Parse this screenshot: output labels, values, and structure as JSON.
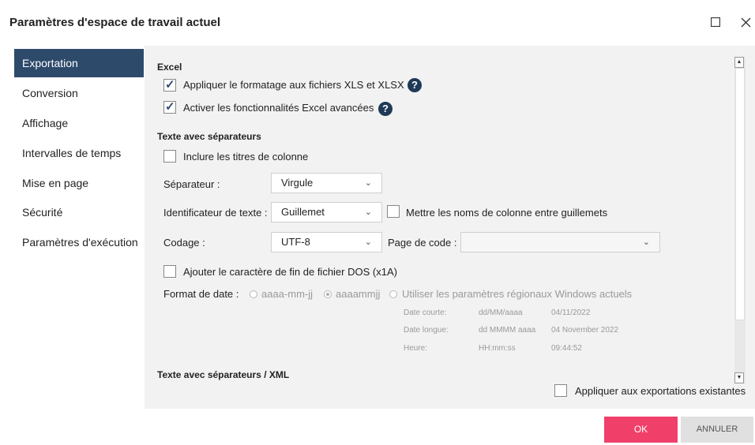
{
  "window": {
    "title": "Paramètres d'espace de travail actuel",
    "maximize_icon": "maximize-icon",
    "close_icon": "close-icon"
  },
  "sidebar": {
    "items": [
      {
        "label": "Exportation",
        "active": true
      },
      {
        "label": "Conversion",
        "active": false
      },
      {
        "label": "Affichage",
        "active": false
      },
      {
        "label": "Intervalles de temps",
        "active": false
      },
      {
        "label": "Mise en page",
        "active": false
      },
      {
        "label": "Sécurité",
        "active": false
      },
      {
        "label": "Paramètres d'exécution",
        "active": false
      }
    ]
  },
  "excel": {
    "title": "Excel",
    "apply_format": {
      "label": "Appliquer le formatage aux fichiers XLS et XLSX",
      "checked": true
    },
    "advanced": {
      "label": "Activer les fonctionnalités Excel avancées",
      "checked": true
    },
    "help": "?"
  },
  "delimited": {
    "title": "Texte avec séparateurs",
    "include_titles": {
      "label": "Inclure les titres de colonne",
      "checked": false
    },
    "separator": {
      "label": "Séparateur :",
      "value": "Virgule"
    },
    "text_qualifier": {
      "label": "Identificateur de texte :",
      "value": "Guillemet"
    },
    "quote_names": {
      "label": "Mettre les noms de colonne entre guillemets",
      "checked": false
    },
    "encoding": {
      "label": "Codage :",
      "value": "UTF-8"
    },
    "code_page": {
      "label": "Page de code :",
      "value": ""
    },
    "dos_eof": {
      "label": "Ajouter le caractère de fin de fichier DOS (x1A)",
      "checked": false
    },
    "date_format": {
      "label": "Format de date :",
      "options": [
        "aaaa-mm-jj",
        "aaaammjj",
        "Utiliser les paramètres régionaux Windows actuels"
      ],
      "selected": "aaaammjj"
    },
    "regional": {
      "short_label": "Date courte:",
      "short_fmt": "dd/MM/aaaa",
      "short_val": "04/11/2022",
      "long_label": "Date longue:",
      "long_fmt": "dd MMMM aaaa",
      "long_val": "04 November 2022",
      "time_label": "Heure:",
      "time_fmt": "HH:mm:ss",
      "time_val": "09:44:52"
    }
  },
  "xml": {
    "title": "Texte avec séparateurs / XML",
    "apply_existing": {
      "label": "Appliquer aux exportations existantes",
      "checked": false
    }
  },
  "footer": {
    "ok": "OK",
    "cancel": "ANNULER"
  },
  "colors": {
    "sidebar_active": "#2d4a6b",
    "ok_button": "#f0406a",
    "panel_bg": "#f2f2f2"
  }
}
